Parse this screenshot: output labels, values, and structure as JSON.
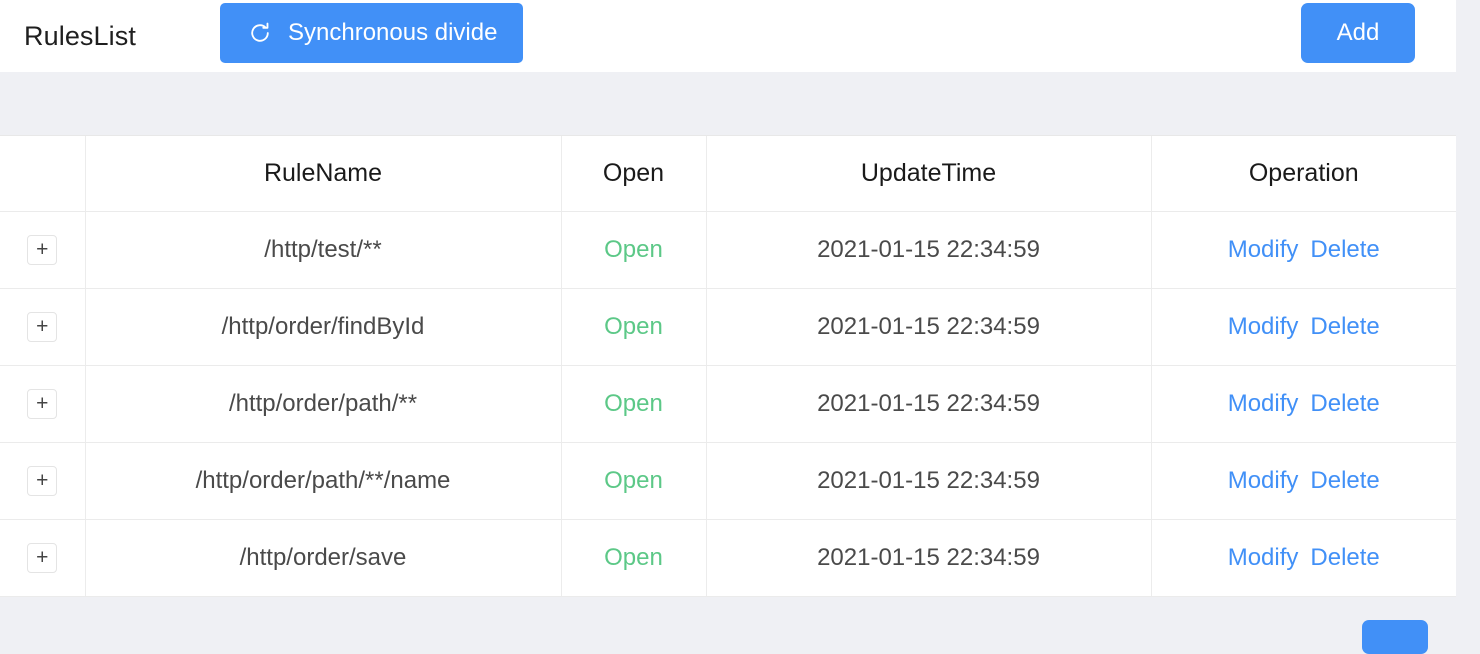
{
  "header": {
    "title": "RulesList",
    "sync_label": "Synchronous divide",
    "sync_icon": "refresh-icon",
    "add_label": "Add"
  },
  "table": {
    "columns": [
      "",
      "RuleName",
      "Open",
      "UpdateTime",
      "Operation"
    ],
    "expand_glyph": "+",
    "rows": [
      {
        "expand": "+",
        "rule_name": "/http/test/**",
        "status": "Open",
        "update_time": "2021-01-15 22:34:59",
        "modify_label": "Modify",
        "delete_label": "Delete"
      },
      {
        "expand": "+",
        "rule_name": "/http/order/findById",
        "status": "Open",
        "update_time": "2021-01-15 22:34:59",
        "modify_label": "Modify",
        "delete_label": "Delete"
      },
      {
        "expand": "+",
        "rule_name": "/http/order/path/**",
        "status": "Open",
        "update_time": "2021-01-15 22:34:59",
        "modify_label": "Modify",
        "delete_label": "Delete"
      },
      {
        "expand": "+",
        "rule_name": "/http/order/path/**/name",
        "status": "Open",
        "update_time": "2021-01-15 22:34:59",
        "modify_label": "Modify",
        "delete_label": "Delete"
      },
      {
        "expand": "+",
        "rule_name": "/http/order/save",
        "status": "Open",
        "update_time": "2021-01-15 22:34:59",
        "modify_label": "Modify",
        "delete_label": "Delete"
      }
    ]
  },
  "footer": {
    "pager_label": ""
  },
  "colors": {
    "accent": "#4190f7",
    "status_open": "#5cc887",
    "page_background": "#eff0f4",
    "surface": "#ffffff"
  }
}
